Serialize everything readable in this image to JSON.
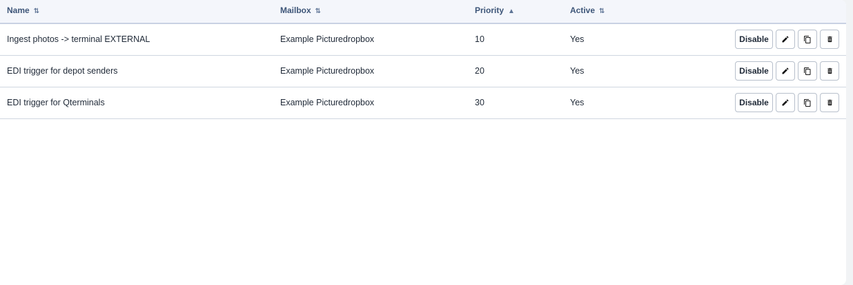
{
  "table": {
    "columns": [
      {
        "label": "Name",
        "sort": "⇅"
      },
      {
        "label": "Mailbox",
        "sort": "⇅"
      },
      {
        "label": "Priority",
        "sort": "▲"
      },
      {
        "label": "Active",
        "sort": "⇅"
      }
    ],
    "rows": [
      {
        "name": "Ingest photos -> terminal EXTERNAL",
        "mailbox": "Example Picturedropbox",
        "priority": "10",
        "active": "Yes",
        "toggle_label": "Disable"
      },
      {
        "name": "EDI trigger for depot senders",
        "mailbox": "Example Picturedropbox",
        "priority": "20",
        "active": "Yes",
        "toggle_label": "Disable"
      },
      {
        "name": "EDI trigger for Qterminals",
        "mailbox": "Example Picturedropbox",
        "priority": "30",
        "active": "Yes",
        "toggle_label": "Disable"
      }
    ],
    "row_actions": {
      "edit_icon": "pencil-icon",
      "duplicate_icon": "copy-icon",
      "delete_icon": "trash-icon"
    }
  }
}
